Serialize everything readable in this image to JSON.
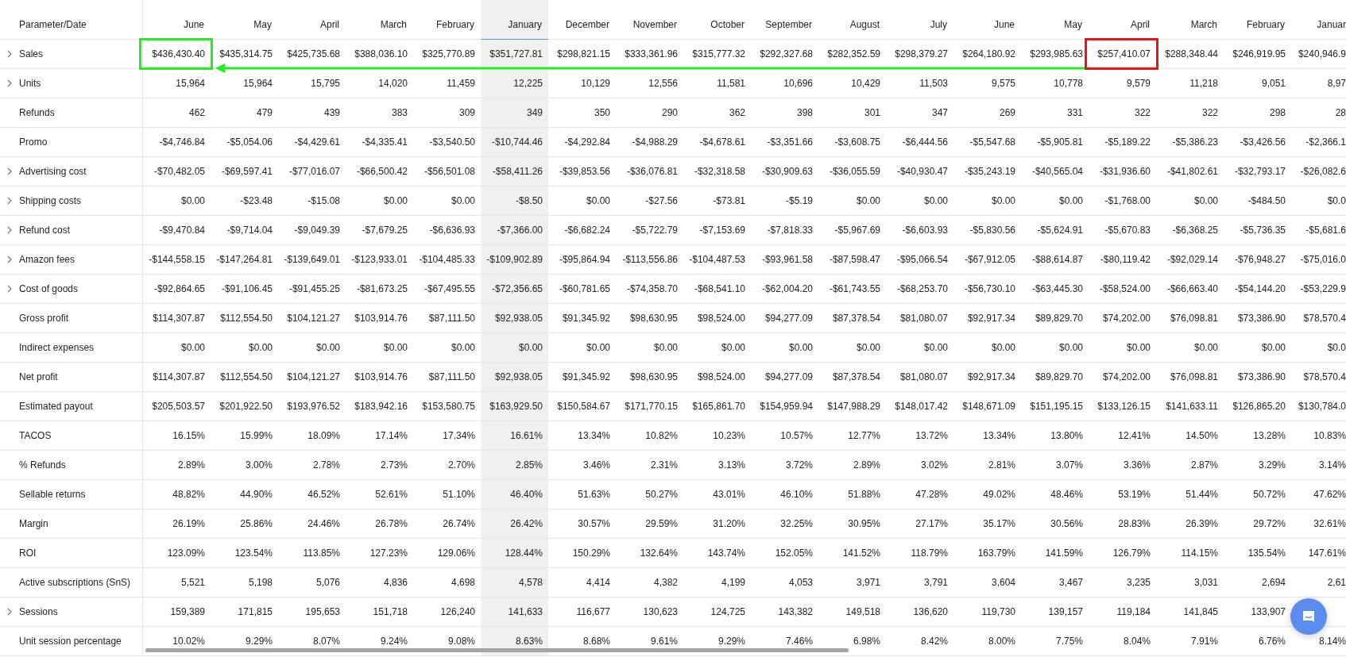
{
  "table": {
    "header_label": "Parameter/Date",
    "columns": [
      {
        "label": "June",
        "selected": false
      },
      {
        "label": "May",
        "selected": false
      },
      {
        "label": "April",
        "selected": false
      },
      {
        "label": "March",
        "selected": false
      },
      {
        "label": "February",
        "selected": false
      },
      {
        "label": "January",
        "selected": true
      },
      {
        "label": "December",
        "selected": false
      },
      {
        "label": "November",
        "selected": false
      },
      {
        "label": "October",
        "selected": false
      },
      {
        "label": "September",
        "selected": false
      },
      {
        "label": "August",
        "selected": false
      },
      {
        "label": "July",
        "selected": false
      },
      {
        "label": "June",
        "selected": false
      },
      {
        "label": "May",
        "selected": false
      },
      {
        "label": "April",
        "selected": false
      },
      {
        "label": "March",
        "selected": false
      },
      {
        "label": "February",
        "selected": false
      },
      {
        "label": "Januar",
        "selected": false
      }
    ],
    "rows": [
      {
        "label": "Sales",
        "expandable": true,
        "values": [
          {
            "text": "$436,430.40",
            "color": "#22ee22"
          },
          "$435,314.75",
          "$425,735.68",
          "$388,036.10",
          "$325,770.89",
          "$351,727.81",
          "$298,821.15",
          "$333,361.96",
          "$315,777.32",
          "$292,327.68",
          "$282,352.59",
          "$298,379.27",
          "$264,180.92",
          "$293,985.63",
          {
            "text": "$257,410.07",
            "color": "#ee1111"
          },
          "$288,348.44",
          "$246,919.95",
          "$240,946.9"
        ]
      },
      {
        "label": "Units",
        "expandable": true,
        "values": [
          "15,964",
          "15,964",
          "15,795",
          "14,020",
          "11,459",
          "12,225",
          "10,129",
          "12,556",
          "11,581",
          "10,696",
          "10,429",
          "11,503",
          "9,575",
          "10,778",
          "9,579",
          "11,218",
          "9,051",
          "8,97"
        ]
      },
      {
        "label": "Refunds",
        "expandable": false,
        "values": [
          "462",
          "479",
          "439",
          "383",
          "309",
          "349",
          "350",
          "290",
          "362",
          "398",
          "301",
          "347",
          "269",
          "331",
          "322",
          "322",
          "298",
          "28"
        ]
      },
      {
        "label": "Promo",
        "expandable": false,
        "values": [
          "-$4,746.84",
          "-$5,054.06",
          "-$4,429.61",
          "-$4,335.41",
          "-$3,540.50",
          "-$10,744.46",
          "-$4,292.84",
          "-$4,988.29",
          "-$4,678.61",
          "-$3,351.66",
          "-$3,608.75",
          "-$6,444.56",
          "-$5,547.68",
          "-$5,905.81",
          "-$5,189.22",
          "-$5,386.23",
          "-$3,426.56",
          "-$2,366.1"
        ]
      },
      {
        "label": "Advertising cost",
        "expandable": true,
        "values": [
          "-$70,482.05",
          "-$69,597.41",
          "-$77,016.07",
          "-$66,500.42",
          "-$56,501.08",
          "-$58,411.26",
          "-$39,853.56",
          "-$36,076.81",
          "-$32,318.58",
          "-$30,909.63",
          "-$36,055.59",
          "-$40,930.47",
          "-$35,243.19",
          "-$40,565.04",
          "-$31,936.60",
          "-$41,802.61",
          "-$32,793.17",
          "-$26,082.6"
        ]
      },
      {
        "label": "Shipping costs",
        "expandable": true,
        "values": [
          "$0.00",
          "-$23.48",
          "-$15.08",
          "$0.00",
          "$0.00",
          "-$8.50",
          "$0.00",
          "-$27.56",
          "-$73.81",
          "-$5.19",
          "$0.00",
          "$0.00",
          "$0.00",
          "$0.00",
          "-$1,768.00",
          "$0.00",
          "-$484.50",
          "$0.0"
        ]
      },
      {
        "label": "Refund cost",
        "expandable": true,
        "values": [
          "-$9,470.84",
          "-$9,714.04",
          "-$9,049.39",
          "-$7,679.25",
          "-$6,636.93",
          "-$7,366.00",
          "-$6,682.24",
          "-$5,722.79",
          "-$7,153.69",
          "-$7,818.33",
          "-$5,967.69",
          "-$6,603.93",
          "-$5,830.56",
          "-$5,624.91",
          "-$5,670.83",
          "-$6,368.25",
          "-$5,736.35",
          "-$5,681.6"
        ]
      },
      {
        "label": "Amazon fees",
        "expandable": true,
        "values": [
          "-$144,558.15",
          "-$147,264.81",
          "-$139,649.01",
          "-$123,933.01",
          "-$104,485.33",
          "-$109,902.89",
          "-$95,864.94",
          "-$113,556.86",
          "-$104,487.53",
          "-$93,961.58",
          "-$87,598.47",
          "-$95,066.54",
          "-$67,912.05",
          "-$88,614.87",
          "-$80,119.42",
          "-$92,029.14",
          "-$76,948.27",
          "-$75,016.0"
        ]
      },
      {
        "label": "Cost of goods",
        "expandable": true,
        "values": [
          "-$92,864.65",
          "-$91,106.45",
          "-$91,455.25",
          "-$81,673.25",
          "-$67,495.55",
          "-$72,356.65",
          "-$60,781.65",
          "-$74,358.70",
          "-$68,541.10",
          "-$62,004.20",
          "-$61,743.55",
          "-$68,253.70",
          "-$56,730.10",
          "-$63,445.30",
          "-$58,524.00",
          "-$66,663.40",
          "-$54,144.20",
          "-$53,229.9"
        ]
      },
      {
        "label": "Gross profit",
        "expandable": false,
        "values": [
          "$114,307.87",
          "$112,554.50",
          "$104,121.27",
          "$103,914.76",
          "$87,111.50",
          "$92,938.05",
          "$91,345.92",
          "$98,630.95",
          "$98,524.00",
          "$94,277.09",
          "$87,378.54",
          "$81,080.07",
          "$92,917.34",
          "$89,829.70",
          "$74,202.00",
          "$76,098.81",
          "$73,386.90",
          "$78,570.4"
        ]
      },
      {
        "label": "Indirect expenses",
        "expandable": false,
        "values": [
          "$0.00",
          "$0.00",
          "$0.00",
          "$0.00",
          "$0.00",
          "$0.00",
          "$0.00",
          "$0.00",
          "$0.00",
          "$0.00",
          "$0.00",
          "$0.00",
          "$0.00",
          "$0.00",
          "$0.00",
          "$0.00",
          "$0.00",
          "$0.0"
        ]
      },
      {
        "label": "Net profit",
        "expandable": false,
        "values": [
          "$114,307.87",
          "$112,554.50",
          "$104,121.27",
          "$103,914.76",
          "$87,111.50",
          "$92,938.05",
          "$91,345.92",
          "$98,630.95",
          "$98,524.00",
          "$94,277.09",
          "$87,378.54",
          "$81,080.07",
          "$92,917.34",
          "$89,829.70",
          "$74,202.00",
          "$76,098.81",
          "$73,386.90",
          "$78,570.4"
        ]
      },
      {
        "label": "Estimated payout",
        "expandable": false,
        "values": [
          "$205,503.57",
          "$201,922.50",
          "$193,976.52",
          "$183,942.16",
          "$153,580.75",
          "$163,929.50",
          "$150,584.67",
          "$171,770.15",
          "$165,861.70",
          "$154,959.94",
          "$147,988.29",
          "$148,017.42",
          "$148,671.09",
          "$151,195.15",
          "$133,126.15",
          "$141,633.11",
          "$126,865.20",
          "$130,784.0"
        ]
      },
      {
        "label": "TACOS",
        "expandable": false,
        "values": [
          "16.15%",
          "15.99%",
          "18.09%",
          "17.14%",
          "17.34%",
          "16.61%",
          "13.34%",
          "10.82%",
          "10.23%",
          "10.57%",
          "12.77%",
          "13.72%",
          "13.34%",
          "13.80%",
          "12.41%",
          "14.50%",
          "13.28%",
          "10.83%"
        ]
      },
      {
        "label": "% Refunds",
        "expandable": false,
        "values": [
          "2.89%",
          "3.00%",
          "2.78%",
          "2.73%",
          "2.70%",
          "2.85%",
          "3.46%",
          "2.31%",
          "3.13%",
          "3.72%",
          "2.89%",
          "3.02%",
          "2.81%",
          "3.07%",
          "3.36%",
          "2.87%",
          "3.29%",
          "3.14%"
        ]
      },
      {
        "label": "Sellable returns",
        "expandable": false,
        "values": [
          "48.82%",
          "44.90%",
          "46.52%",
          "52.61%",
          "51.10%",
          "46.40%",
          "51.63%",
          "50.27%",
          "43.01%",
          "46.10%",
          "51.88%",
          "47.28%",
          "49.02%",
          "48.46%",
          "53.19%",
          "51.44%",
          "50.72%",
          "47.62%"
        ]
      },
      {
        "label": "Margin",
        "expandable": false,
        "values": [
          "26.19%",
          "25.86%",
          "24.46%",
          "26.78%",
          "26.74%",
          "26.42%",
          "30.57%",
          "29.59%",
          "31.20%",
          "32.25%",
          "30.95%",
          "27.17%",
          "35.17%",
          "30.56%",
          "28.83%",
          "26.39%",
          "29.72%",
          "32.61%"
        ]
      },
      {
        "label": "ROI",
        "expandable": false,
        "values": [
          "123.09%",
          "123.54%",
          "113.85%",
          "127.23%",
          "129.06%",
          "128.44%",
          "150.29%",
          "132.64%",
          "143.74%",
          "152.05%",
          "141.52%",
          "118.79%",
          "163.79%",
          "141.59%",
          "126.79%",
          "114.15%",
          "135.54%",
          "147.61%"
        ]
      },
      {
        "label": "Active subscriptions (SnS)",
        "expandable": false,
        "values": [
          "5,521",
          "5,198",
          "5,076",
          "4,836",
          "4,698",
          "4,578",
          "4,414",
          "4,382",
          "4,199",
          "4,053",
          "3,971",
          "3,791",
          "3,604",
          "3,467",
          "3,235",
          "3,031",
          "2,694",
          "2,61"
        ]
      },
      {
        "label": "Sessions",
        "expandable": true,
        "values": [
          "159,389",
          "171,815",
          "195,653",
          "151,718",
          "126,240",
          "141,633",
          "116,677",
          "130,623",
          "124,725",
          "143,382",
          "149,518",
          "136,620",
          "119,730",
          "139,157",
          "119,184",
          "141,845",
          "133,907"
        ]
      },
      {
        "label": "Unit session percentage",
        "expandable": false,
        "values": [
          "10.02%",
          "9.29%",
          "8.07%",
          "9.24%",
          "9.08%",
          "8.63%",
          "8.68%",
          "9.61%",
          "9.29%",
          "7.46%",
          "6.98%",
          "8.42%",
          "8.00%",
          "7.75%",
          "8.04%",
          "7.91%",
          "6.76%",
          "8.14%"
        ]
      }
    ],
    "arrow": {
      "color": "#22ee22"
    }
  }
}
